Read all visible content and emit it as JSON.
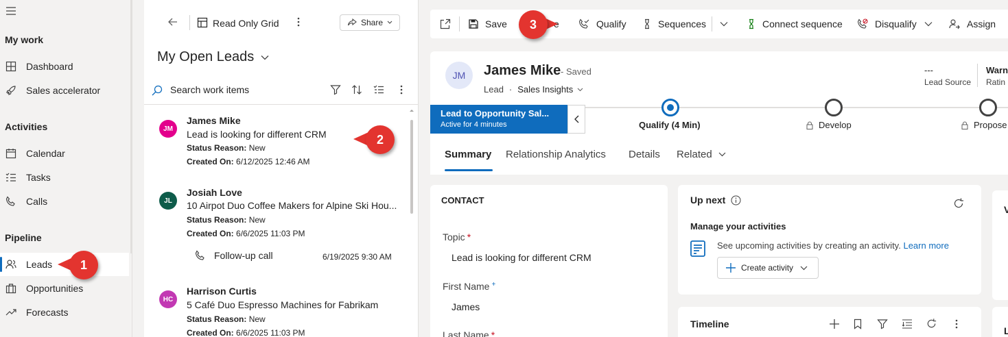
{
  "nav": {
    "sections": [
      {
        "title": "My work",
        "items": [
          {
            "label": "Dashboard",
            "icon": "grid-icon"
          },
          {
            "label": "Sales accelerator",
            "icon": "rocket-icon"
          }
        ]
      },
      {
        "title": "Activities",
        "items": [
          {
            "label": "Calendar",
            "icon": "calendar-icon"
          },
          {
            "label": "Tasks",
            "icon": "tasks-icon"
          },
          {
            "label": "Calls",
            "icon": "phone-icon"
          }
        ]
      },
      {
        "title": "Pipeline",
        "items": [
          {
            "label": "Leads",
            "icon": "person-icon"
          },
          {
            "label": "Opportunities",
            "icon": "briefcase-icon"
          },
          {
            "label": "Forecasts",
            "icon": "trend-icon"
          }
        ]
      }
    ]
  },
  "list": {
    "grid_label": "Read Only Grid",
    "share_label": "Share",
    "view_title": "My Open Leads",
    "search_placeholder": "Search work items",
    "status_label": "Status Reason:",
    "created_label": "Created On:",
    "cards": [
      {
        "initials": "JM",
        "avatar_color": "#e3008c",
        "name": "James Mike",
        "topic": "Lead is looking for different CRM",
        "status": "New",
        "created": "6/12/2025 12:46 AM"
      },
      {
        "initials": "JL",
        "avatar_color": "#0e5c4a",
        "name": "Josiah Love",
        "topic": "10 Airpot Duo Coffee Makers for Alpine Ski Hou...",
        "status": "New",
        "created": "6/6/2025 11:03 PM",
        "activity": {
          "label": "Follow-up call",
          "date": "6/19/2025 9:30 AM"
        }
      },
      {
        "initials": "HC",
        "avatar_color": "#c239b3",
        "name": "Harrison Curtis",
        "topic": "5 Café Duo Espresso Machines for Fabrikam",
        "status": "New",
        "created": "6/6/2025 11:03 PM"
      }
    ]
  },
  "form": {
    "commands": {
      "save": "Save",
      "hidden": "e",
      "qualify": "Qualify",
      "sequences": "Sequences",
      "connect": "Connect sequence",
      "disqualify": "Disqualify",
      "assign": "Assign"
    },
    "header": {
      "initials": "JM",
      "name": "James Mike",
      "saved": "- Saved",
      "entity": "Lead",
      "dot": "·",
      "form_selector": "Sales Insights",
      "lead_source_value": "---",
      "lead_source_label": "Lead Source",
      "rating_value": "Warn",
      "rating_label": "Ratin"
    },
    "bpf": {
      "title": "Lead to Opportunity Sal...",
      "status": "Active for 4 minutes",
      "stages": [
        {
          "label": "Qualify  (4 Min)"
        },
        {
          "label": "Develop"
        },
        {
          "label": "Propose"
        }
      ]
    },
    "tabs": [
      "Summary",
      "Relationship Analytics",
      "Details",
      "Related"
    ],
    "contact": {
      "title": "CONTACT",
      "topic_label": "Topic",
      "topic_value": "Lead is looking for different CRM",
      "first_name_label": "First Name",
      "first_name_value": "James",
      "last_name_label": "Last Name",
      "required_mark": "*",
      "recommended_mark": "+"
    },
    "upnext": {
      "title": "Up next",
      "heading": "Manage your activities",
      "text": "See upcoming activities by creating an activity.",
      "link": "Learn more",
      "create_label": "Create activity"
    },
    "timeline": {
      "title": "Timeline"
    },
    "side_panel": {
      "top_letter": "V",
      "bottom_letter": "L"
    }
  },
  "callouts": [
    "1",
    "2",
    "3"
  ],
  "colors": {
    "accent": "#0f6cbd",
    "callout": "#e3342f",
    "required": "#c50f1f"
  }
}
